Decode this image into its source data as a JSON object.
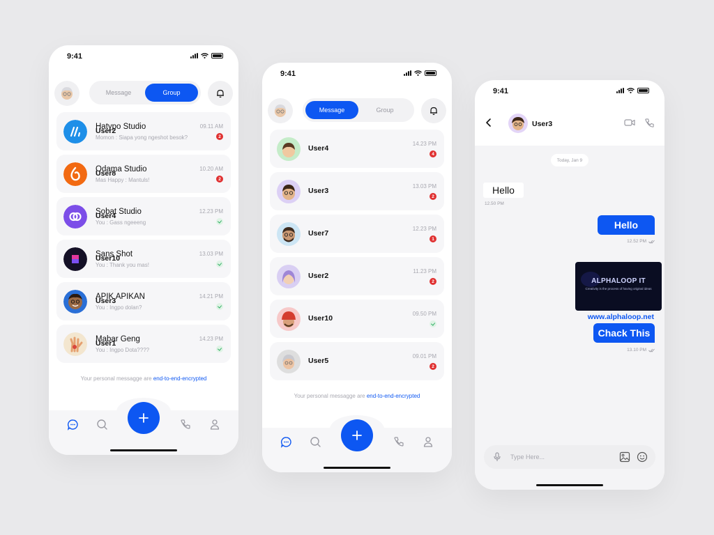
{
  "phone_left": {
    "time": "9:41",
    "tabs": [
      "Message",
      "Group"
    ],
    "active_tab": 1,
    "rows": [
      {
        "name": "Hatypo Studio",
        "name2": "User2",
        "preview": "Momon : Siapa yong ngeshot besok?",
        "time": "09.11 AM",
        "badge": "2",
        "avatar": "hatypo-logo-icon"
      },
      {
        "name": "Odama Studio",
        "name2": "User8",
        "preview": "Mas Happy : Mantuls!",
        "time": "10.20 AM",
        "badge": "2",
        "avatar": "odama-logo-icon"
      },
      {
        "name": "Sobat Studio",
        "name2": "User4",
        "preview": "You : Gass ngeeeng",
        "time": "12.23 PM",
        "badge": "",
        "avatar": "sobat-logo-icon"
      },
      {
        "name": "Sans Shot",
        "name2": "User10",
        "preview": "You : Thank you mas!",
        "time": "13.03 PM",
        "badge": "",
        "avatar": "sansshot-logo-icon"
      },
      {
        "name": "APIK APIKAN",
        "name2": "User3",
        "preview": "You : Ingpo dolan?",
        "time": "14.21 PM",
        "badge": "",
        "avatar": "apik-avatar-icon"
      },
      {
        "name": "Mabar Geng",
        "name2": "User1",
        "preview": "You : Ingpo Dota????",
        "time": "14.23 PM",
        "badge": "",
        "avatar": "mabar-hand-icon"
      }
    ],
    "encryption_text": "Your personal messagge are ",
    "encryption_link": "end-to-end-encrypted"
  },
  "phone_middle": {
    "time": "9:41",
    "tabs": [
      "Message",
      "Group"
    ],
    "active_tab": 0,
    "rows": [
      {
        "name": "User4",
        "time": "14.23 PM",
        "badge": "4",
        "color": "#c5ecc9"
      },
      {
        "name": "User3",
        "time": "13.03 PM",
        "badge": "2",
        "color": "#dcd0f5"
      },
      {
        "name": "User7",
        "time": "12.23 PM",
        "badge": "1",
        "color": "#cce5f4"
      },
      {
        "name": "User2",
        "time": "11.23 PM",
        "badge": "2",
        "color": "#d9cff3"
      },
      {
        "name": "User10",
        "time": "09.50 PM",
        "badge": "",
        "color": "#f7c9c9"
      },
      {
        "name": "User5",
        "time": "09.01 PM",
        "badge": "2",
        "color": "#dedede"
      }
    ],
    "encryption_text": "Your personal messagge are ",
    "encryption_link": "end-to-end-encrypted"
  },
  "phone_right": {
    "time": "9:41",
    "contact": "User3",
    "date": "Today, Jan 9",
    "incoming": {
      "text": "Hello",
      "time": "12.50 PM"
    },
    "outgoing1": {
      "text": "Hello",
      "time": "12.52 PM"
    },
    "image_card": {
      "title": "ALPHALOOP IT",
      "subtitle": "Creativity is the process of having original ideas"
    },
    "link_text": "www.alphaloop.net",
    "outgoing2": {
      "text": "Chack This",
      "time": "13.10 PM"
    },
    "input_placeholder": "Type Here..."
  },
  "colors": {
    "accent": "#0d57f2",
    "badge": "#e03131",
    "read": "#38b26a"
  }
}
